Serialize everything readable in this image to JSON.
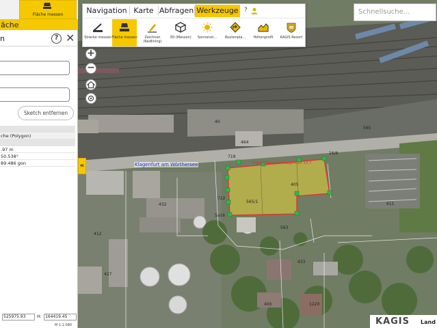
{
  "left_panel": {
    "tab_label": "Fläche messen",
    "header": "äche",
    "title": "n",
    "sketch_button": "Sketch entfernen",
    "results": [
      "che (Polygon)",
      ".97 m",
      "50.538°",
      "89.486 gon"
    ],
    "coords": {
      "x_value": "525975.93",
      "h_label": "H:",
      "h_value": "164419.45",
      "scale": "M 1:1.080"
    }
  },
  "toolbar": {
    "tabs": [
      "Navigation",
      "Karte",
      "Abfragen",
      "Werkzeuge"
    ],
    "active_tab": "Werkzeuge",
    "help_icon": "?",
    "tools": [
      {
        "label": "Strecke messen",
        "icon": "ruler-icon"
      },
      {
        "label": "Fläche messen",
        "icon": "area-icon",
        "active": true
      },
      {
        "label": "Zeichnen (Redlining)",
        "icon": "pencil-icon"
      },
      {
        "label": "3D (Messen)",
        "icon": "cube-icon"
      },
      {
        "label": "Sonnenst...",
        "icon": "sun-icon"
      },
      {
        "label": "Routenpla...",
        "icon": "route-icon"
      },
      {
        "label": "Höhenprofil",
        "icon": "profile-icon"
      },
      {
        "label": "KAGIS Resort",
        "icon": "crest-icon"
      }
    ]
  },
  "search": {
    "placeholder": "Schnellsuche..."
  },
  "map": {
    "street_label": "Klagenfurt am Wörthersee",
    "parcel_label": "Fläche Beispiel Klagenfurt 13.7",
    "parcel_numbers": [
      "40",
      "464",
      "719",
      "722",
      "432",
      "412",
      "563",
      "5a16",
      "565",
      "565/1",
      "405",
      "611",
      "433",
      "1220",
      "400",
      "427",
      "16/6"
    ]
  },
  "logo": {
    "brand": "KAGIS",
    "suffix": "Land"
  },
  "colors": {
    "accent": "#f6c800",
    "polygon_edge": "#e53030",
    "vertex": "#38b34a",
    "street_label": "#1a35c6"
  }
}
